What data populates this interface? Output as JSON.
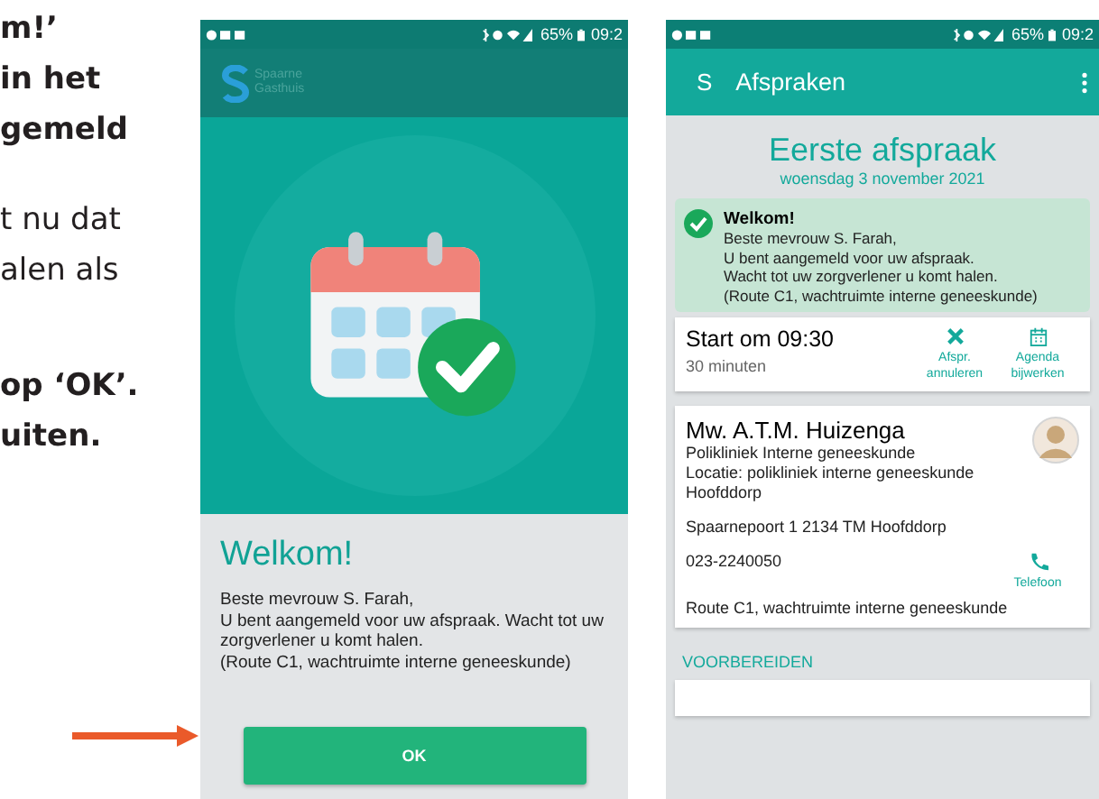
{
  "document_text": {
    "heading_lines": [
      "m!’",
      "in het",
      "gemeld"
    ],
    "body_lines": [
      "t nu dat",
      "alen als"
    ],
    "instruction_lines": [
      "op ‘OK’.",
      "uiten."
    ]
  },
  "welcome_screen": {
    "status_bar": {
      "battery": "65%",
      "time": "09:2"
    },
    "logo_text": [
      "Spaarne",
      "Gasthuis"
    ],
    "title": "Welkom!",
    "message_lines": [
      "Beste mevrouw S. Farah,",
      "U bent aangemeld voor uw afspraak. Wacht tot uw zorgverlener u komt halen.",
      "(Route C1, wachtruimte interne geneeskunde)"
    ],
    "button": "OK"
  },
  "appointments_screen": {
    "status_bar": {
      "battery": "65%",
      "time": "09:2"
    },
    "app_bar": {
      "logo_letter": "S",
      "title": "Afspraken"
    },
    "heading": "Eerste afspraak",
    "date": "woensdag 3 november 2021",
    "notice": {
      "title": "Welkom!",
      "lines": [
        "Beste mevrouw S. Farah,",
        "U bent aangemeld voor uw afspraak.",
        "Wacht tot uw zorgverlener u komt halen.",
        "(Route C1, wachtruimte interne geneeskunde)"
      ]
    },
    "time_card": {
      "start": "Start om 09:30",
      "duration": "30 minuten",
      "actions": [
        {
          "kind": "cancel",
          "label": "Afspr. annuleren"
        },
        {
          "kind": "calendar",
          "label": "Agenda bijwerken"
        }
      ]
    },
    "provider_card": {
      "name": "Mw. A.T.M. Huizenga",
      "department": "Polikliniek Interne geneeskunde",
      "location": "Locatie: polikliniek interne geneeskunde Hoofddorp",
      "address": "Spaarnepoort 1 2134 TM Hoofddorp",
      "phone": "023-2240050",
      "phone_action": "Telefoon",
      "route": "Route C1, wachtruimte interne geneeskunde"
    },
    "section_heading": "VOORBEREIDEN"
  }
}
